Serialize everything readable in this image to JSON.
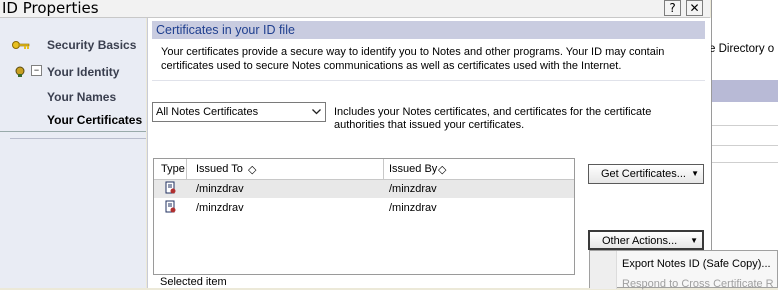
{
  "window": {
    "title": "ID Properties",
    "help_glyph": "?",
    "close_glyph": "✕"
  },
  "sidebar": {
    "items": [
      {
        "label": "Security Basics",
        "icon": "key-icon"
      },
      {
        "label": "Your Identity",
        "icon": "identity-icon",
        "expander": "−"
      },
      {
        "label": "Your Names"
      },
      {
        "label": "Your Certificates",
        "selected": true
      }
    ]
  },
  "main": {
    "header": "Certificates in your ID file",
    "description": "Your certificates provide a secure way to identify you to Notes and other programs. Your ID may contain certificates used to secure Notes communications as well as certificates used with the Internet.",
    "filter": {
      "selected": "All Notes Certificates",
      "description": "Includes your Notes certificates, and certificates for the certificate authorities that issued your certificates."
    },
    "table": {
      "columns": [
        "Type",
        "Issued To",
        "Issued By"
      ],
      "sort_glyph": "◇",
      "rows": [
        {
          "issued_to": "/minzdrav",
          "issued_by": "/minzdrav",
          "selected": true
        },
        {
          "issued_to": "/minzdrav",
          "issued_by": "/minzdrav",
          "selected": false
        }
      ]
    },
    "get_certificates_label": "Get Certificates...",
    "other_actions_label": "Other Actions...",
    "dropdown_glyph": "▼",
    "selected_item_label": "Selected item"
  },
  "menu": {
    "items": [
      "Export Notes ID (Safe Copy)...",
      "Respond to Cross Certificate R"
    ]
  },
  "background_app": {
    "text": "e Directory o"
  },
  "colors": {
    "header_bg": "#c9cce0",
    "header_text": "#1f3f8f",
    "sidebar_bg": "#e9ecf4",
    "selected_row": "#e8e8e8"
  }
}
